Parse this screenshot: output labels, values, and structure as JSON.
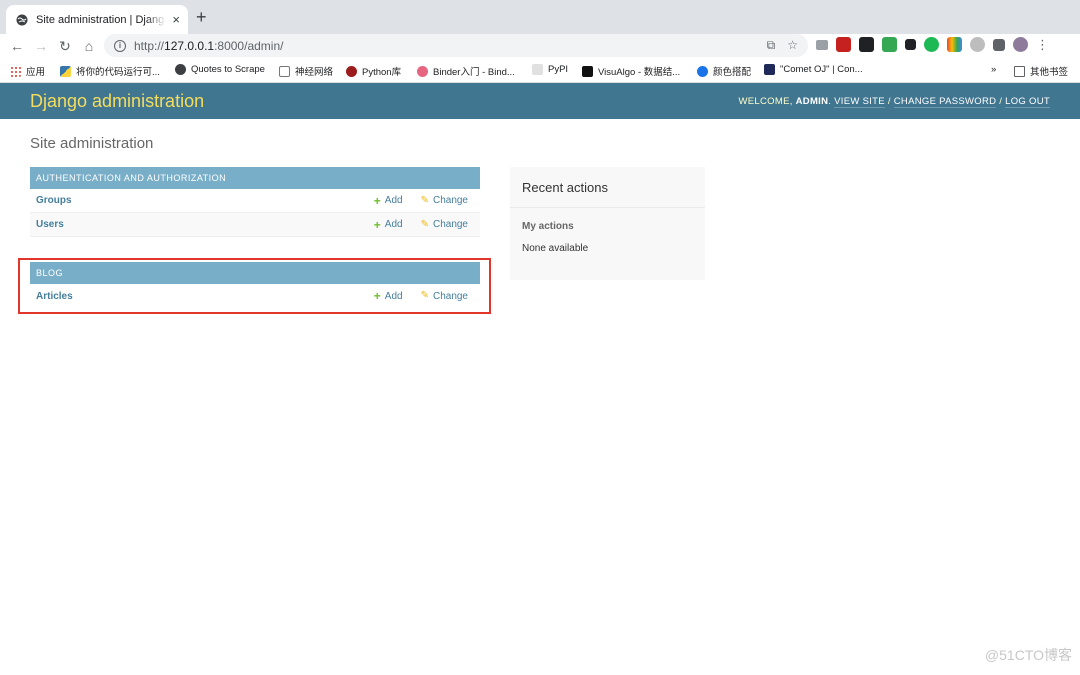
{
  "browser": {
    "tab_title": "Site administration | Django site admin",
    "tab_close": "×",
    "new_tab": "+",
    "url_scheme": "http://",
    "url_host": "127.0.0.1",
    "url_rest": ":8000/admin/",
    "bookmarks": [
      {
        "label": "应用",
        "icon": "apps-grid-icon",
        "color": "#d93025"
      },
      {
        "label": "将你的代码运行可...",
        "icon": "python-icon",
        "color": "#3776ab"
      },
      {
        "label": "Quotes to Scrape",
        "icon": "globe-icon",
        "color": "#3c4043"
      },
      {
        "label": "神经网络",
        "icon": "grid-image-icon",
        "color": "#777777"
      },
      {
        "label": "Python库",
        "icon": "python-lib-icon",
        "color": "#9b1c1c"
      },
      {
        "label": "Binder入门 - Bind...",
        "icon": "binder-icon",
        "color": "#e66581"
      },
      {
        "label": "PyPI",
        "icon": "pypi-icon",
        "color": "#e0e0e0"
      },
      {
        "label": "VisuAlgo - 数据结...",
        "icon": "visualgo-icon",
        "color": "#111111"
      },
      {
        "label": "颜色搭配",
        "icon": "color-c-icon",
        "color": "#1a73e8"
      },
      {
        "label": "\"Comet OJ\" | Con...",
        "icon": "comet-oj-icon",
        "color": "#1f2a5a"
      }
    ],
    "bookmarks_more": "»",
    "other_bookmarks": "其他书签"
  },
  "header": {
    "branding": "Django administration",
    "welcome": "Welcome,",
    "username": "admin",
    "sep": ".",
    "view_site": "View site",
    "change_password": "Change password",
    "log_out": "Log out",
    "slash": "/"
  },
  "page_title": "Site administration",
  "apps": [
    {
      "caption": "Authentication and Authorization",
      "models": [
        {
          "name": "Groups",
          "add": "Add",
          "change": "Change"
        },
        {
          "name": "Users",
          "add": "Add",
          "change": "Change"
        }
      ]
    },
    {
      "caption": "Blog",
      "models": [
        {
          "name": "Articles",
          "add": "Add",
          "change": "Change"
        }
      ]
    }
  ],
  "recent_actions": {
    "title": "Recent actions",
    "my_actions": "My actions",
    "empty": "None available"
  },
  "watermark": "@51CTO博客",
  "colors": {
    "header_bg": "#417690",
    "branding": "#f5dd5d",
    "module_caption_bg": "#79aec8",
    "link": "#447e9b",
    "add_icon": "#70bf2b",
    "change_icon": "#efb80b",
    "highlight": "#e0362c"
  }
}
